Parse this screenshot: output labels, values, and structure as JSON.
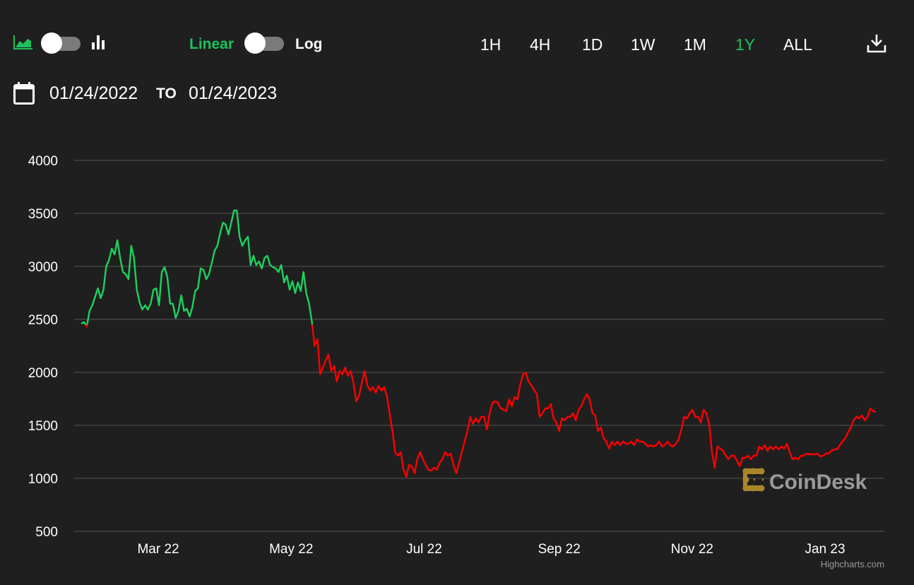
{
  "toolbar": {
    "chart_type_icons": [
      "area-chart-icon",
      "bar-chart-icon"
    ],
    "scale_linear": "Linear",
    "scale_log": "Log",
    "ranges": [
      "1H",
      "4H",
      "1D",
      "1W",
      "1M",
      "1Y",
      "ALL"
    ],
    "active_range": "1Y",
    "download_icon": "download-icon",
    "accent": "#1dc25c"
  },
  "date_range": {
    "from": "01/24/2022",
    "to_label": "TO",
    "to": "01/24/2023",
    "icon": "calendar-icon"
  },
  "watermark": "CoinDesk",
  "credits": "Highcharts.com",
  "chart_data": {
    "type": "line",
    "title": "",
    "xlabel": "",
    "ylabel": "",
    "x_start": "2022-01-24",
    "x_end": "2023-01-24",
    "x_days": 365,
    "ylim": [
      500,
      4000
    ],
    "yticks": [
      500,
      1000,
      1500,
      2000,
      2500,
      3000,
      3500,
      4000
    ],
    "xticks": [
      {
        "label": "Mar 22",
        "day": 36
      },
      {
        "label": "May 22",
        "day": 97
      },
      {
        "label": "Jul 22",
        "day": 158
      },
      {
        "label": "Sep 22",
        "day": 220
      },
      {
        "label": "Nov 22",
        "day": 281
      },
      {
        "label": "Jan 23",
        "day": 342
      }
    ],
    "grid": true,
    "zone_threshold": 2450,
    "colors": {
      "above": "#1dd15e",
      "below": "#ff0000",
      "grid": "#555555"
    },
    "values": [
      2460,
      2473,
      2433,
      2580,
      2633,
      2713,
      2793,
      2700,
      2780,
      3000,
      3060,
      3167,
      3113,
      3247,
      3080,
      2947,
      2927,
      2880,
      3193,
      3080,
      2780,
      2660,
      2593,
      2633,
      2593,
      2647,
      2780,
      2793,
      2633,
      2947,
      2993,
      2900,
      2647,
      2647,
      2513,
      2580,
      2727,
      2580,
      2600,
      2527,
      2613,
      2767,
      2793,
      2980,
      2967,
      2880,
      2927,
      3033,
      3147,
      3193,
      3313,
      3413,
      3393,
      3300,
      3413,
      3527,
      3527,
      3280,
      3193,
      3247,
      3280,
      3013,
      3100,
      3013,
      3047,
      2980,
      3080,
      3100,
      3013,
      2993,
      2980,
      2947,
      3013,
      2847,
      2913,
      2780,
      2860,
      2747,
      2847,
      2767,
      2947,
      2747,
      2647,
      2480,
      2247,
      2313,
      1980,
      2047,
      2113,
      2167,
      2013,
      2060,
      1913,
      2013,
      1980,
      2047,
      1967,
      2013,
      1900,
      1727,
      1780,
      1900,
      2013,
      1873,
      1827,
      1860,
      1807,
      1873,
      1827,
      1860,
      1780,
      1613,
      1447,
      1247,
      1213,
      1247,
      1080,
      1013,
      1127,
      1113,
      1047,
      1187,
      1247,
      1180,
      1127,
      1080,
      1073,
      1100,
      1080,
      1147,
      1180,
      1247,
      1213,
      1233,
      1127,
      1047,
      1147,
      1247,
      1347,
      1447,
      1580,
      1513,
      1567,
      1527,
      1580,
      1580,
      1460,
      1613,
      1713,
      1727,
      1713,
      1660,
      1647,
      1633,
      1747,
      1680,
      1767,
      1747,
      1880,
      1980,
      1993,
      1913,
      1880,
      1833,
      1793,
      1580,
      1613,
      1660,
      1660,
      1700,
      1567,
      1527,
      1447,
      1567,
      1547,
      1580,
      1580,
      1613,
      1547,
      1647,
      1680,
      1747,
      1793,
      1747,
      1613,
      1593,
      1447,
      1480,
      1380,
      1347,
      1280,
      1347,
      1313,
      1347,
      1313,
      1347,
      1327,
      1327,
      1347,
      1313,
      1367,
      1347,
      1347,
      1327,
      1300,
      1313,
      1300,
      1313,
      1347,
      1300,
      1313,
      1347,
      1313,
      1300,
      1327,
      1367,
      1460,
      1580,
      1567,
      1613,
      1647,
      1580,
      1580,
      1527,
      1647,
      1613,
      1513,
      1247,
      1100,
      1300,
      1280,
      1260,
      1213,
      1180,
      1213,
      1213,
      1167,
      1113,
      1193,
      1193,
      1213,
      1180,
      1213,
      1213,
      1300,
      1273,
      1313,
      1260,
      1300,
      1273,
      1300,
      1273,
      1300,
      1280,
      1327,
      1247,
      1180,
      1193,
      1180,
      1213,
      1213,
      1233,
      1227,
      1227,
      1227,
      1233,
      1207,
      1213,
      1233,
      1233,
      1260,
      1273,
      1273,
      1313,
      1347,
      1380,
      1433,
      1480,
      1547,
      1580,
      1567,
      1593,
      1547,
      1580,
      1660,
      1633,
      1627
    ]
  }
}
